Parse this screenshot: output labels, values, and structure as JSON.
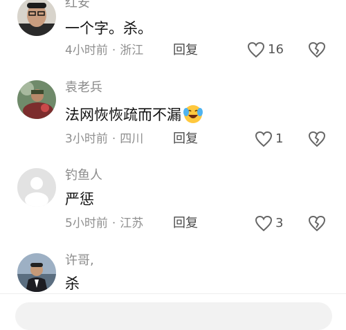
{
  "comments": [
    {
      "name": "红安",
      "text": "一个字。杀。",
      "time": "4小时前",
      "location": "浙江",
      "reply": "回复",
      "likes": "16"
    },
    {
      "name": "袁老兵",
      "text": "法网恢恢疏而不漏",
      "time": "3小时前",
      "location": "四川",
      "reply": "回复",
      "likes": "1",
      "emoji": "crying-laughing-emoji"
    },
    {
      "name": "钓鱼人",
      "text": "严惩",
      "time": "5小时前",
      "location": "江苏",
      "reply": "回复",
      "likes": "3"
    },
    {
      "name": "许哥,",
      "text": "杀"
    }
  ],
  "separator": "·",
  "colors": {
    "name": "#8b8b8b",
    "text": "#111111",
    "meta": "#8f8f8f",
    "icon": "#666666"
  }
}
